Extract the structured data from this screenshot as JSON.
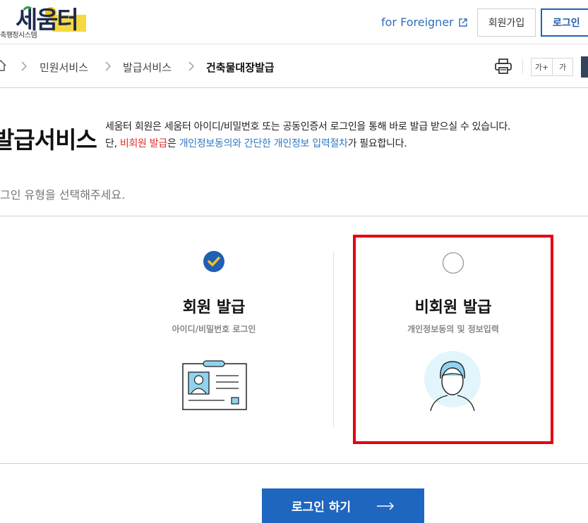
{
  "header": {
    "logo_text": "세움터",
    "logo_sub": "축행정시스템",
    "foreigner_link": "for Foreigner",
    "join_button": "회원가입",
    "login_button": "로그인"
  },
  "breadcrumb": {
    "items": [
      "민원서비스",
      "발급서비스",
      "건축물대장발급"
    ]
  },
  "tools": {
    "font_plus": "가+",
    "font_minus": "가"
  },
  "page": {
    "title": "발급서비스",
    "desc_line1": "세움터 회원은 세움터 아이디/비밀번호 또는 공동인증서 로그인을 통해 바로 발급 받으실 수 있습니다.",
    "desc_line2_prefix": "단, ",
    "desc_line2_red": "비회원 발급",
    "desc_line2_mid": "은 ",
    "desc_line2_blue": "개인정보동의와 간단한 개인정보 입력절차",
    "desc_line2_suffix": "가 필요합니다.",
    "choose_text": "그인 유형을 선택해주세요."
  },
  "options": {
    "member": {
      "title": "회원 발급",
      "subtitle": "아이디/비밀번호 로그인",
      "selected": true
    },
    "guest": {
      "title": "비회원 발급",
      "subtitle": "개인정보동의 및 정보입력",
      "selected": false
    }
  },
  "submit": {
    "label": "로그인 하기"
  },
  "colors": {
    "brand_blue": "#1e66bf",
    "highlight_red": "#e60012",
    "check_blue": "#1f5fb4",
    "check_yellow": "#f5c518"
  }
}
